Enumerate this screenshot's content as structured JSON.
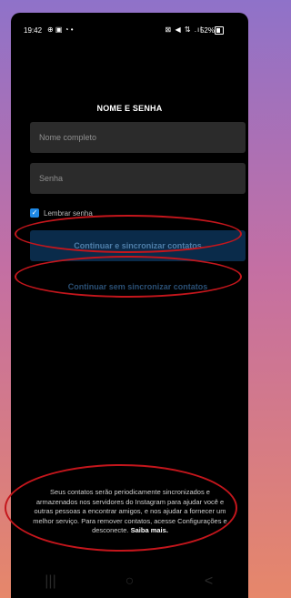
{
  "status_bar": {
    "time": "19:42",
    "left_icons": "⊕ ▣ ◔ •",
    "right_icons": "⊠ ◀ ⇅ .ıl",
    "battery": "52%"
  },
  "form": {
    "title": "NOME E SENHA",
    "name_placeholder": "Nome completo",
    "password_placeholder": "Senha",
    "remember_label": "Lembrar senha",
    "remember_checked": true,
    "primary_button": "Continuar e sincronizar contatos",
    "secondary_button": "Continuar sem sincronizar contatos"
  },
  "footer": {
    "text": "Seus contatos serão periodicamente sincronizados e armazenados nos servidores do Instagram para ajudar você e outras pessoas a encontrar amigos, e nos ajudar a fornecer um melhor serviço. Para remover contatos, acesse Configurações e desconecte.",
    "link": "Saiba mais."
  },
  "navbar": {
    "recent": "|||",
    "home": "○",
    "back": "<"
  },
  "colors": {
    "accent_blue": "#1e88e5",
    "annotation_red": "#c4161c"
  }
}
